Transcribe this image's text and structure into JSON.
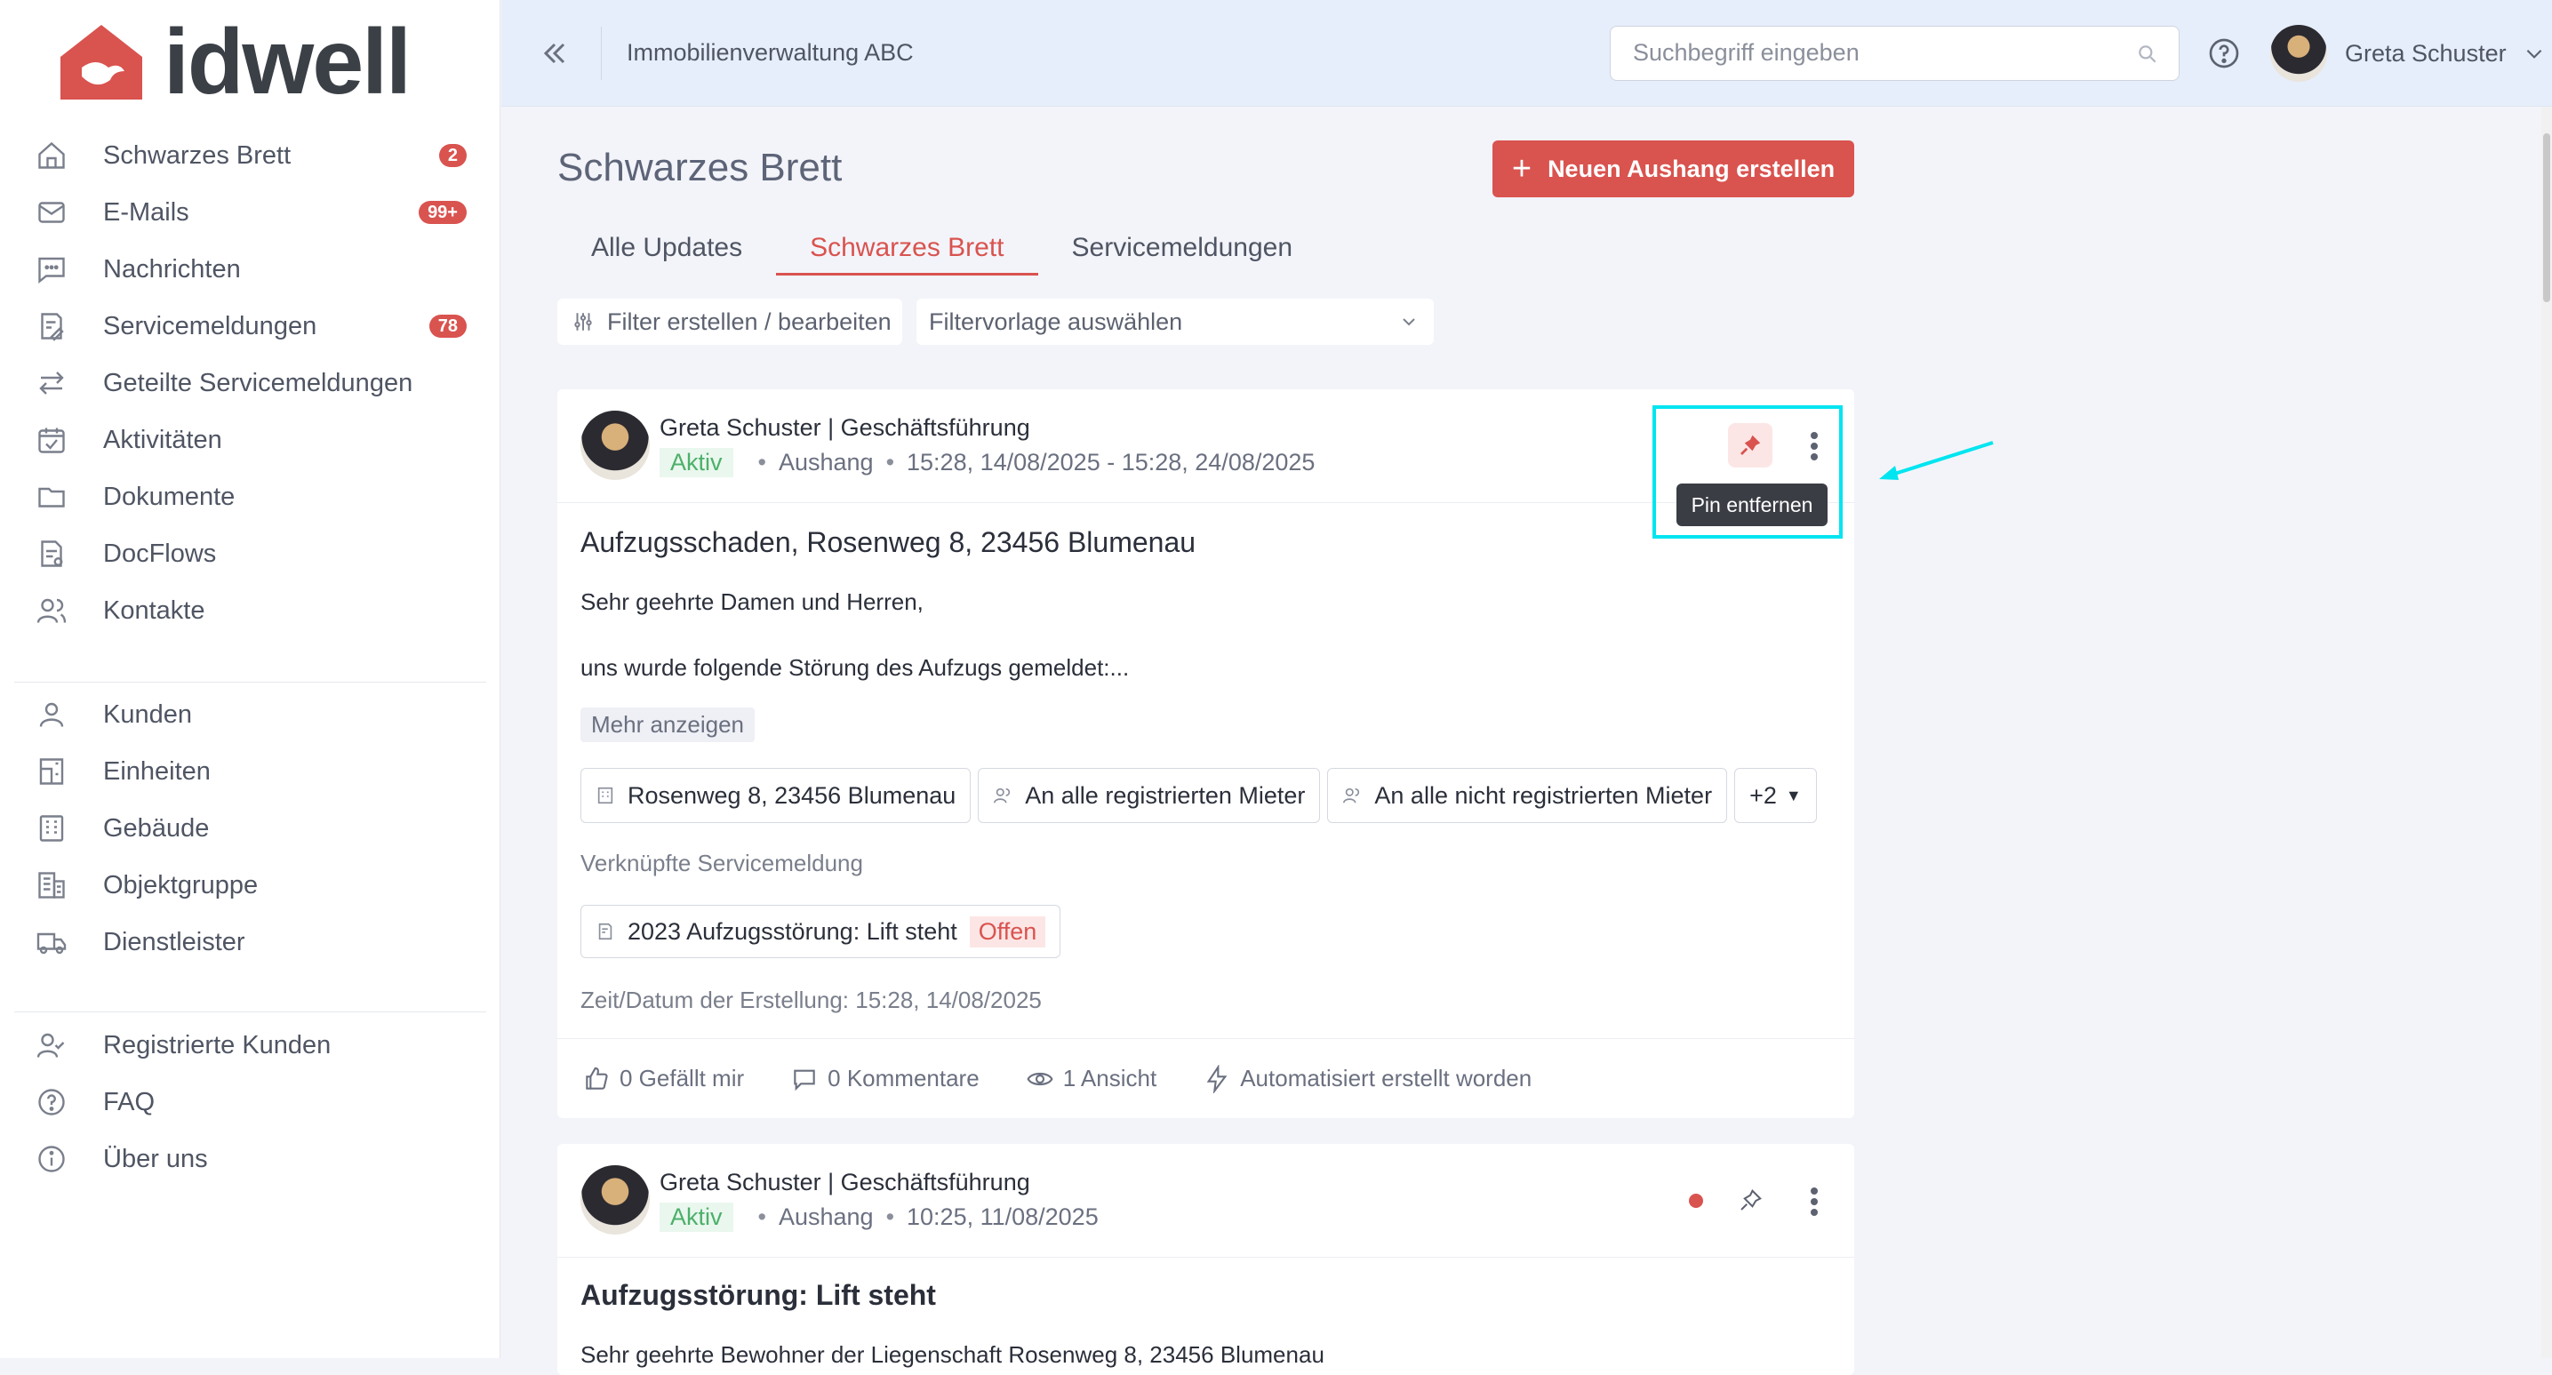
{
  "brand": {
    "name": "idwell",
    "color": "#d9534f"
  },
  "sidebar": {
    "groups": [
      [
        {
          "label": "Schwarzes Brett",
          "icon": "home-icon",
          "badge": "2"
        },
        {
          "label": "E-Mails",
          "icon": "mail-icon",
          "badge": "99+"
        },
        {
          "label": "Nachrichten",
          "icon": "message-icon",
          "badge": ""
        },
        {
          "label": "Servicemeldungen",
          "icon": "service-report-icon",
          "badge": "78"
        },
        {
          "label": "Geteilte Servicemeldungen",
          "icon": "share-arrows-icon",
          "badge": ""
        },
        {
          "label": "Aktivitäten",
          "icon": "calendar-check-icon",
          "badge": ""
        },
        {
          "label": "Dokumente",
          "icon": "folder-icon",
          "badge": ""
        },
        {
          "label": "DocFlows",
          "icon": "docflow-icon",
          "badge": ""
        },
        {
          "label": "Kontakte",
          "icon": "contacts-icon",
          "badge": ""
        }
      ],
      [
        {
          "label": "Kunden",
          "icon": "person-icon",
          "badge": ""
        },
        {
          "label": "Einheiten",
          "icon": "unit-icon",
          "badge": ""
        },
        {
          "label": "Gebäude",
          "icon": "building-icon",
          "badge": ""
        },
        {
          "label": "Objektgruppe",
          "icon": "building-group-icon",
          "badge": ""
        },
        {
          "label": "Dienstleister",
          "icon": "truck-icon",
          "badge": ""
        }
      ],
      [
        {
          "label": "Registrierte Kunden",
          "icon": "person-check-icon",
          "badge": ""
        },
        {
          "label": "FAQ",
          "icon": "question-icon",
          "badge": ""
        },
        {
          "label": "Über uns",
          "icon": "info-icon",
          "badge": ""
        }
      ]
    ]
  },
  "topbar": {
    "org": "Immobilienverwaltung ABC",
    "search_placeholder": "Suchbegriff eingeben",
    "user_name": "Greta Schuster"
  },
  "main": {
    "title": "Schwarzes Brett",
    "new_button": "Neuen Aushang erstellen",
    "tabs": [
      "Alle Updates",
      "Schwarzes Brett",
      "Servicemeldungen"
    ],
    "active_tab": 1,
    "filter_button": "Filter erstellen / bearbeiten",
    "filter_select": "Filtervorlage auswählen"
  },
  "posts": [
    {
      "author": "Greta Schuster | Geschäftsführung",
      "status": "Aktiv",
      "type": "Aushang",
      "date": "15:28, 14/08/2025 - 15:28, 24/08/2025",
      "title": "Aufzugsschaden, Rosenweg 8, 23456 Blumenau",
      "body": [
        "Sehr geehrte Damen und Herren,",
        "uns wurde folgende Störung des Aufzugs gemeldet:..."
      ],
      "more": "Mehr anzeigen",
      "chips": [
        "Rosenweg 8, 23456 Blumenau",
        "An alle registrierten Mieter",
        "An alle nicht registrierten Mieter",
        "+2"
      ],
      "linked_label": "Verknüpfte Servicemeldung",
      "linked_ticket": "2023 Aufzugsstörung: Lift steht",
      "linked_status": "Offen",
      "created": "Zeit/Datum der Erstellung: 15:28, 14/08/2025",
      "likes": "0 Gefällt mir",
      "comments": "0 Kommentare",
      "views": "1 Ansicht",
      "auto": "Automatisiert erstellt worden",
      "tooltip": "Pin entfernen"
    },
    {
      "author": "Greta Schuster | Geschäftsführung",
      "status": "Aktiv",
      "type": "Aushang",
      "date": "10:25, 11/08/2025",
      "title": "Aufzugsstörung: Lift steht",
      "body": [
        "Sehr geehrte Bewohner der Liegenschaft Rosenweg 8, 23456 Blumenau"
      ]
    }
  ]
}
